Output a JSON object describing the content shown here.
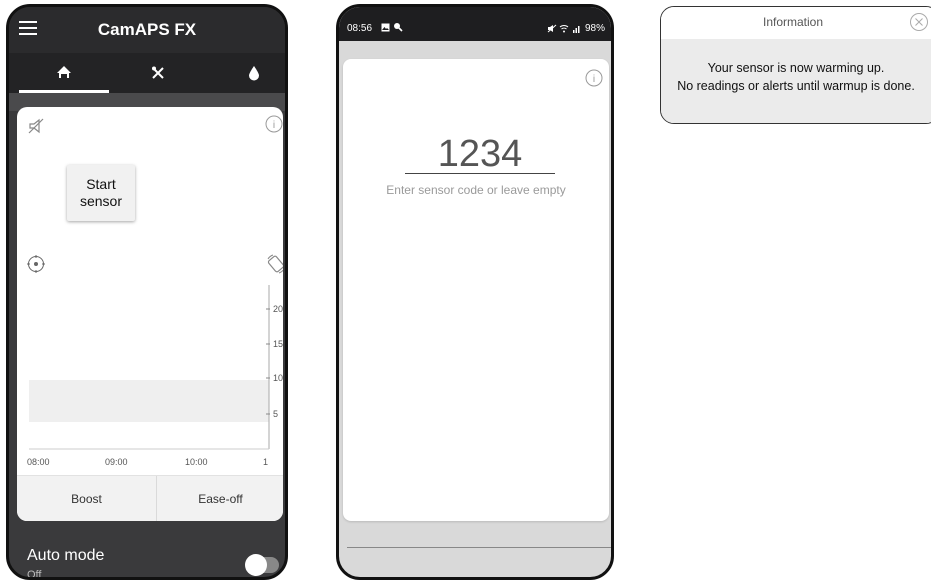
{
  "phone1": {
    "app_title": "CamAPS FX",
    "start_button_line1": "Start",
    "start_button_line2": "sensor",
    "chart_y_ticks": [
      "20",
      "15",
      "10",
      "5"
    ],
    "chart_x_ticks": [
      "08:00",
      "09:00",
      "10:00",
      "1"
    ],
    "boost_label": "Boost",
    "ease_off_label": "Ease-off",
    "auto_mode_label": "Auto mode",
    "auto_mode_status": "Off",
    "icons": [
      "menu-icon",
      "home-icon",
      "meal-icon",
      "drop-icon",
      "mute-icon",
      "info-icon",
      "target-icon",
      "rotate-icon"
    ]
  },
  "phone2": {
    "status_time": "08:56",
    "status_battery": "98%",
    "sensor_code_value": "1234",
    "sensor_code_hint": "Enter sensor code or leave empty"
  },
  "dialog": {
    "title": "Information",
    "message_line1": "Your sensor is now warming up.",
    "message_line2": "No readings or alerts until warmup is done."
  },
  "colors": {
    "header_dark": "#2b2b2d",
    "background_dark": "#3a3a3c",
    "card": "#ffffff",
    "dialog_body": "#ebebeb"
  }
}
